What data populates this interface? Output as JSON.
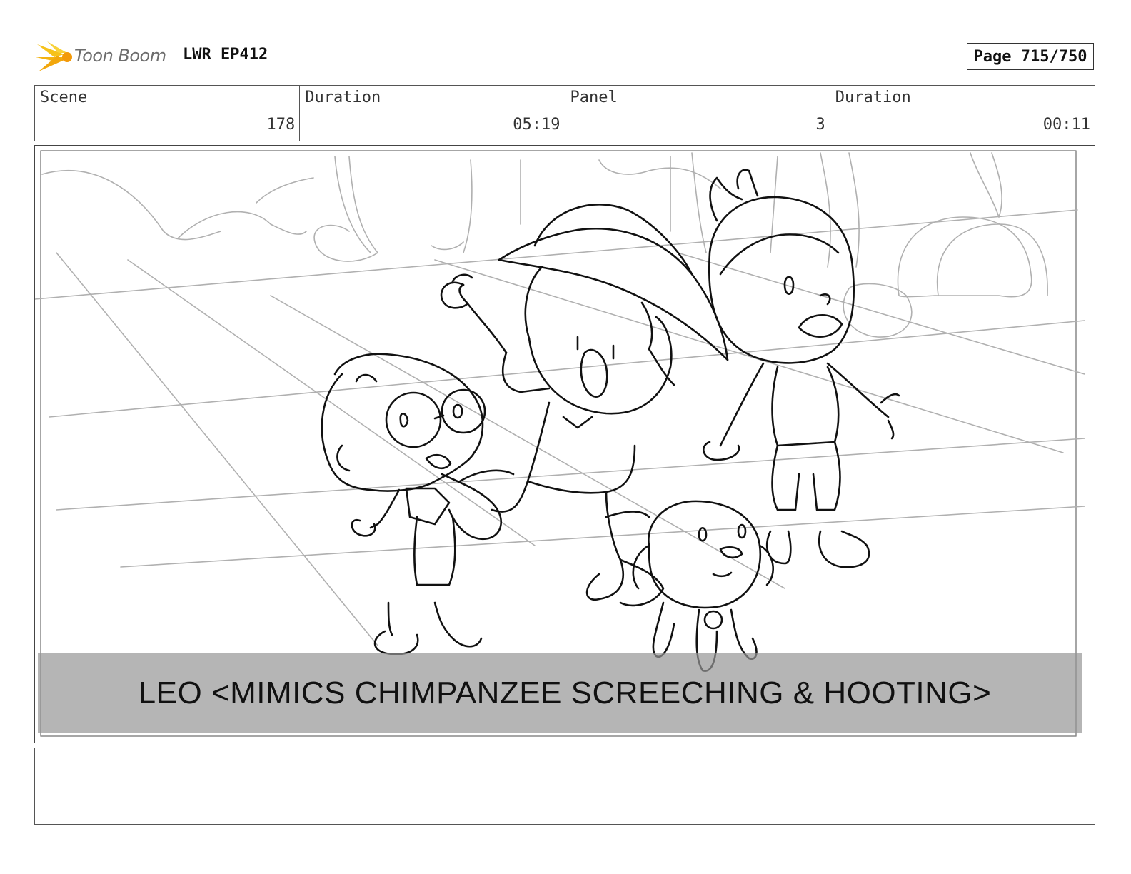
{
  "header": {
    "logo_text": "Toon Boom",
    "episode": "LWR EP412",
    "page": "Page 715/750"
  },
  "info": {
    "scene_label": "Scene",
    "scene_value": "178",
    "scene_duration_label": "Duration",
    "scene_duration_value": "05:19",
    "panel_label": "Panel",
    "panel_value": "3",
    "panel_duration_label": "Duration",
    "panel_duration_value": "00:11"
  },
  "panel": {
    "caption": "LEO <MIMICS CHIMPANZEE SCREECHING & HOOTING>"
  },
  "notes": {
    "text": ""
  }
}
